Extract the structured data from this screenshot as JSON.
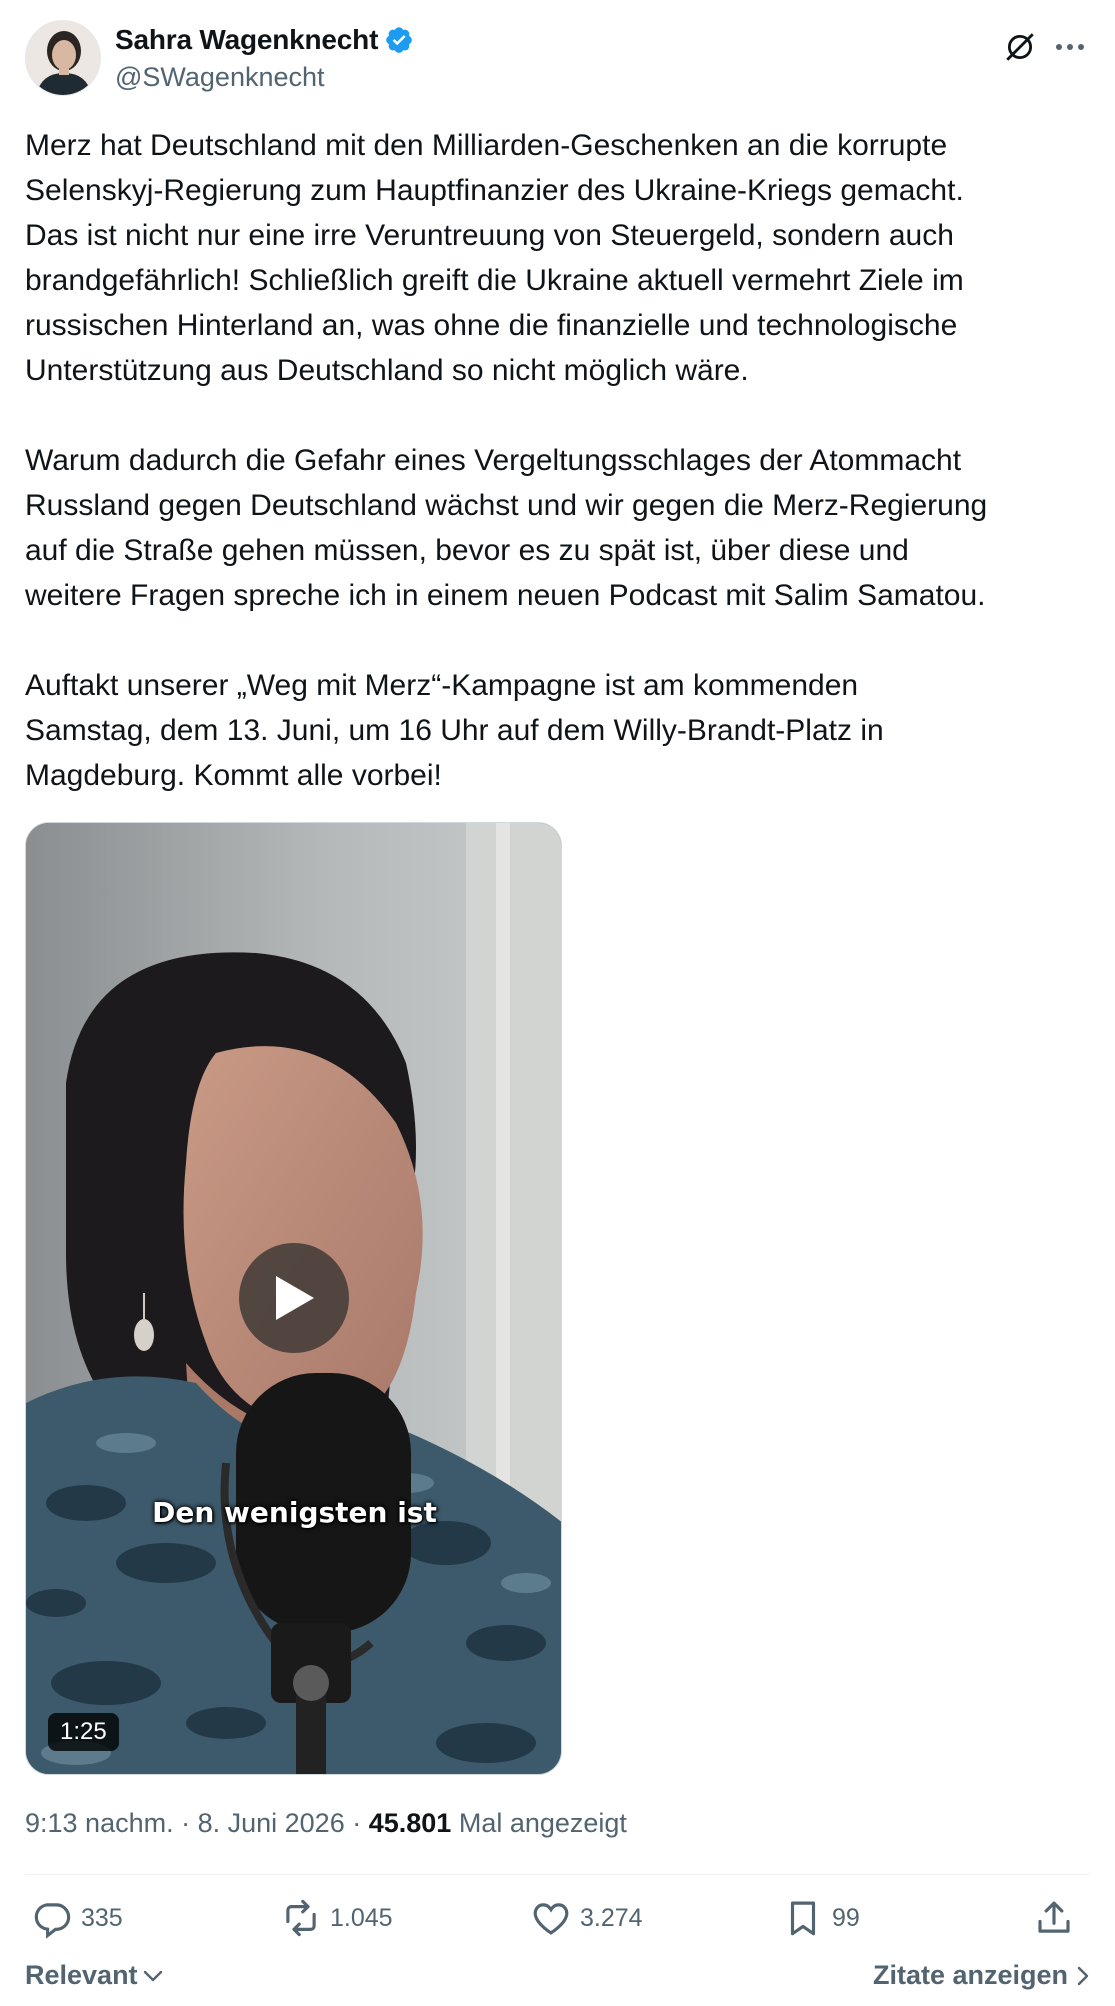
{
  "author": {
    "display_name": "Sahra Wagenknecht",
    "handle": "@SWagenknecht",
    "verified": true,
    "verified_color": "#1d9bf0",
    "avatar_icon": "profile-photo"
  },
  "header_icons": [
    "grok-icon",
    "more-icon"
  ],
  "tweet": {
    "paragraph1": [
      "Merz hat Deutschland mit den Milliarden-Geschenken an die korrupte",
      "Selenskyj-Regierung zum Hauptfinanzier des Ukraine-Kriegs gemacht.",
      "Das ist nicht nur eine irre Veruntreuung von Steuergeld, sondern auch",
      "brandgefährlich! Schließlich greift die Ukraine aktuell vermehrt Ziele im",
      "russischen Hinterland an, was ohne die finanzielle und technologische",
      "Unterstützung aus Deutschland so nicht möglich wäre."
    ],
    "paragraph2": [
      "Warum dadurch die Gefahr eines Vergeltungsschlages der Atommacht",
      "Russland gegen Deutschland wächst und wir gegen die Merz-Regierung",
      "auf die Straße gehen müssen, bevor es zu spät ist, über diese und",
      "weitere Fragen spreche ich in einem neuen Podcast mit Salim Samatou."
    ],
    "paragraph3": [
      "Auftakt unserer „Weg mit Merz“-Kampagne ist am kommenden",
      "Samstag, dem 13. Juni, um 16 Uhr auf dem Willy-Brandt-Platz in",
      "Magdeburg. Kommt alle vorbei!"
    ]
  },
  "video": {
    "caption": "Den wenigsten ist",
    "duration": "1:25",
    "play_icon": "play-icon"
  },
  "meta": {
    "time": "9:13 nachm.",
    "separator": " · ",
    "date": "8. Juni 2026",
    "views": "45.801",
    "views_label": "Mal angezeigt"
  },
  "actions": {
    "replies": "335",
    "reposts": "1.045",
    "likes": "3.274",
    "bookmarks": "99"
  },
  "footer": {
    "sort_label": "Relevant",
    "quotes_label": "Zitate anzeigen"
  }
}
